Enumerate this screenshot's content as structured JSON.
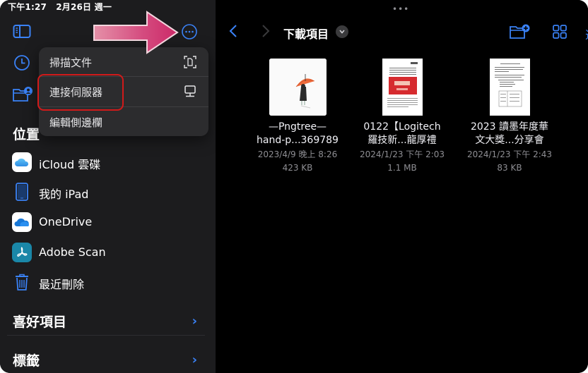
{
  "status_bar": {
    "time": "下午1:27",
    "date": "2月26日 週一"
  },
  "sidebar": {
    "toggle_icon": "sidebar-toggle-icon",
    "recents_icon": "clock-icon",
    "shared_icon": "shared-folder-icon",
    "more_icon": "ellipsis-circle-icon",
    "locations_header": "位置",
    "locations": [
      {
        "label": "iCloud 雲碟",
        "icon": "icloud-icon"
      },
      {
        "label": "我的 iPad",
        "icon": "ipad-icon"
      },
      {
        "label": "OneDrive",
        "icon": "onedrive-icon"
      },
      {
        "label": "Adobe Scan",
        "icon": "adobe-scan-icon"
      },
      {
        "label": "最近刪除",
        "icon": "trash-icon"
      }
    ],
    "favorites_label": "喜好項目",
    "tags_label": "標籤"
  },
  "menu": {
    "items": [
      {
        "label": "掃描文件",
        "icon": "scan-document-icon"
      },
      {
        "label": "連接伺服器",
        "icon": "server-icon",
        "highlighted": true
      },
      {
        "label": "編輯側邊欄",
        "icon": ""
      }
    ]
  },
  "annotation": {
    "arrow_color": "#d4336f",
    "highlight_color": "#d11a1a"
  },
  "main": {
    "grabber": "•••",
    "back_icon": "chevron-left-icon",
    "forward_icon": "chevron-right-icon",
    "title": "下載項目",
    "title_menu_icon": "chevron-down-circle-icon",
    "new_folder_icon": "new-folder-icon",
    "view_icon": "grid-view-icon",
    "select_partial": "選",
    "files": [
      {
        "name_line1": "—Pngtree—",
        "name_line2": "hand-p...369789",
        "date": "2023/4/9 晚上 8:26",
        "size": "423 KB",
        "thumb": "umbrella-image"
      },
      {
        "name_line1": "0122【Logitech",
        "name_line2": "羅技新...龍厚禮",
        "date": "2024/1/23 下午 2:03",
        "size": "1.1 MB",
        "thumb": "pdf-page"
      },
      {
        "name_line1": "2023 讀墨年度華",
        "name_line2": "文大獎...分享會",
        "date": "2024/1/23 下午 2:43",
        "size": "83 KB",
        "thumb": "pdf-page"
      }
    ]
  },
  "colors": {
    "accent": "#3a82f7",
    "sidebar_bg": "#1c1c1e",
    "menu_bg": "#2c2c2e",
    "main_bg": "#000000"
  }
}
